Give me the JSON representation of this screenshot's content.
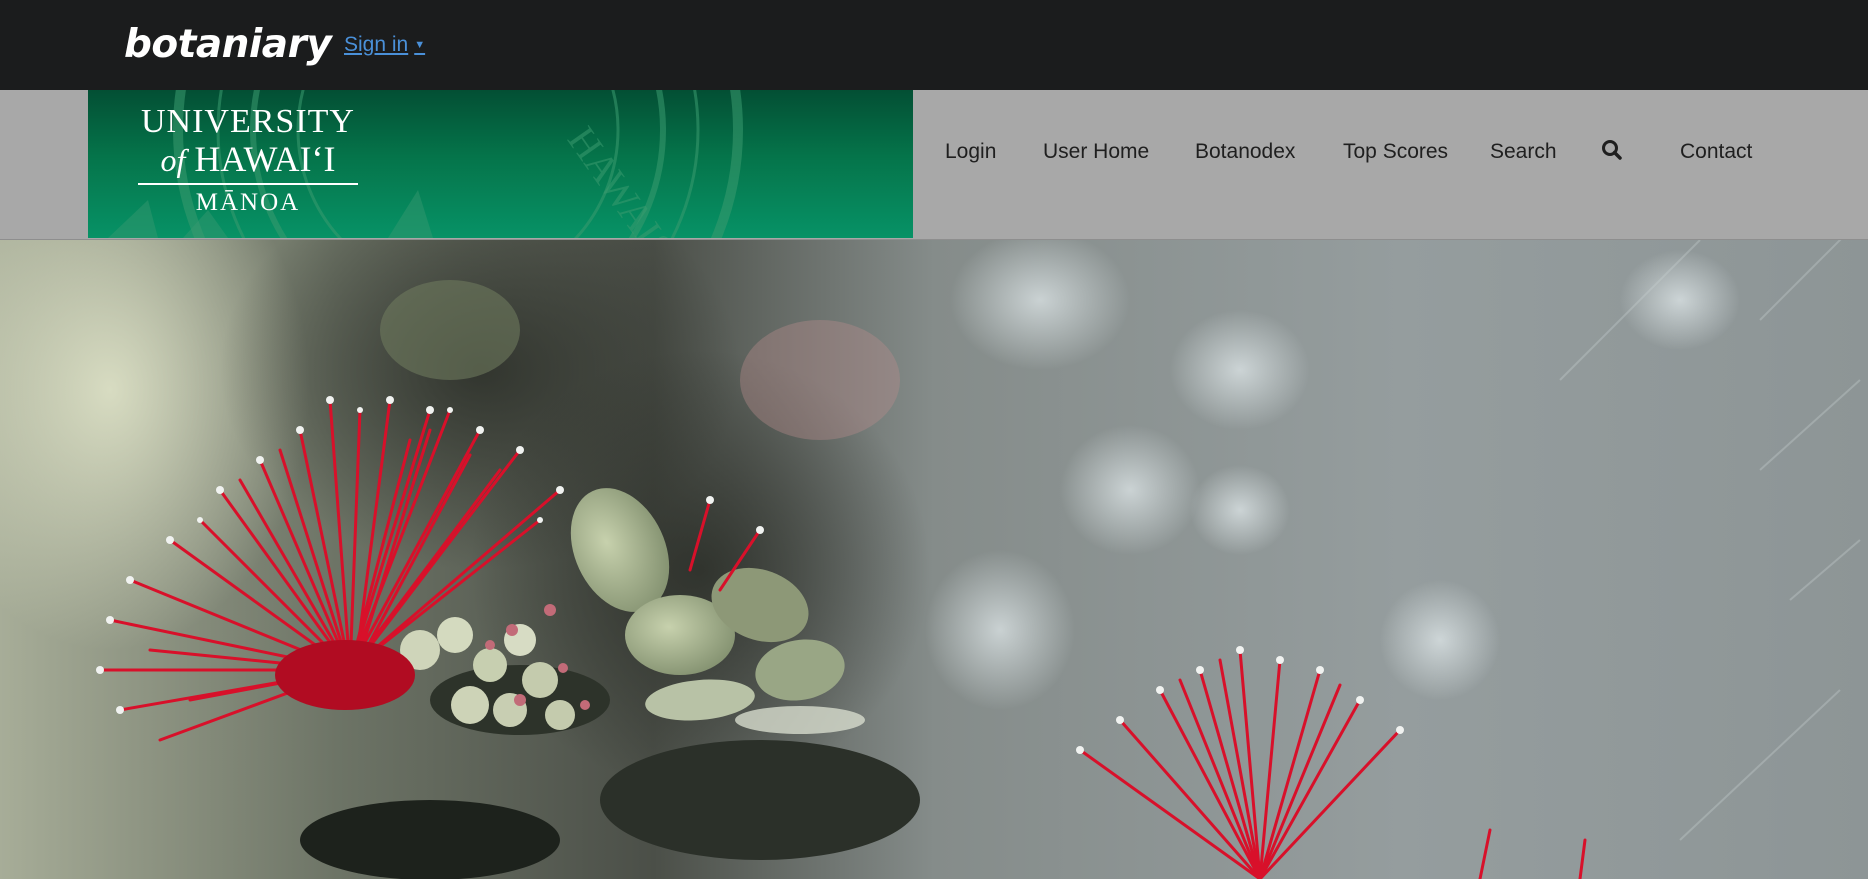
{
  "topbar": {
    "brand": "botaniary",
    "signin_label": "Sign in",
    "signin_caret": "▼"
  },
  "banner": {
    "logo_line1": "UNIVERSITY",
    "logo_of": "of",
    "logo_hawaii": "HAWAI‘I",
    "logo_line3": "MĀNOA",
    "seal_text": "HAWAI‘I"
  },
  "nav": {
    "items": [
      {
        "label": "Login"
      },
      {
        "label": "User Home"
      },
      {
        "label": "Botanodex"
      },
      {
        "label": "Top Scores"
      },
      {
        "label": "Search"
      },
      {
        "label": "Contact"
      }
    ],
    "search_icon": "search-icon"
  },
  "colors": {
    "topbar_bg": "#1b1c1d",
    "nav_bg": "#a8a8a8",
    "banner_green": "#05744a",
    "link_blue": "#4a90d9",
    "flower_red": "#d8102a"
  }
}
